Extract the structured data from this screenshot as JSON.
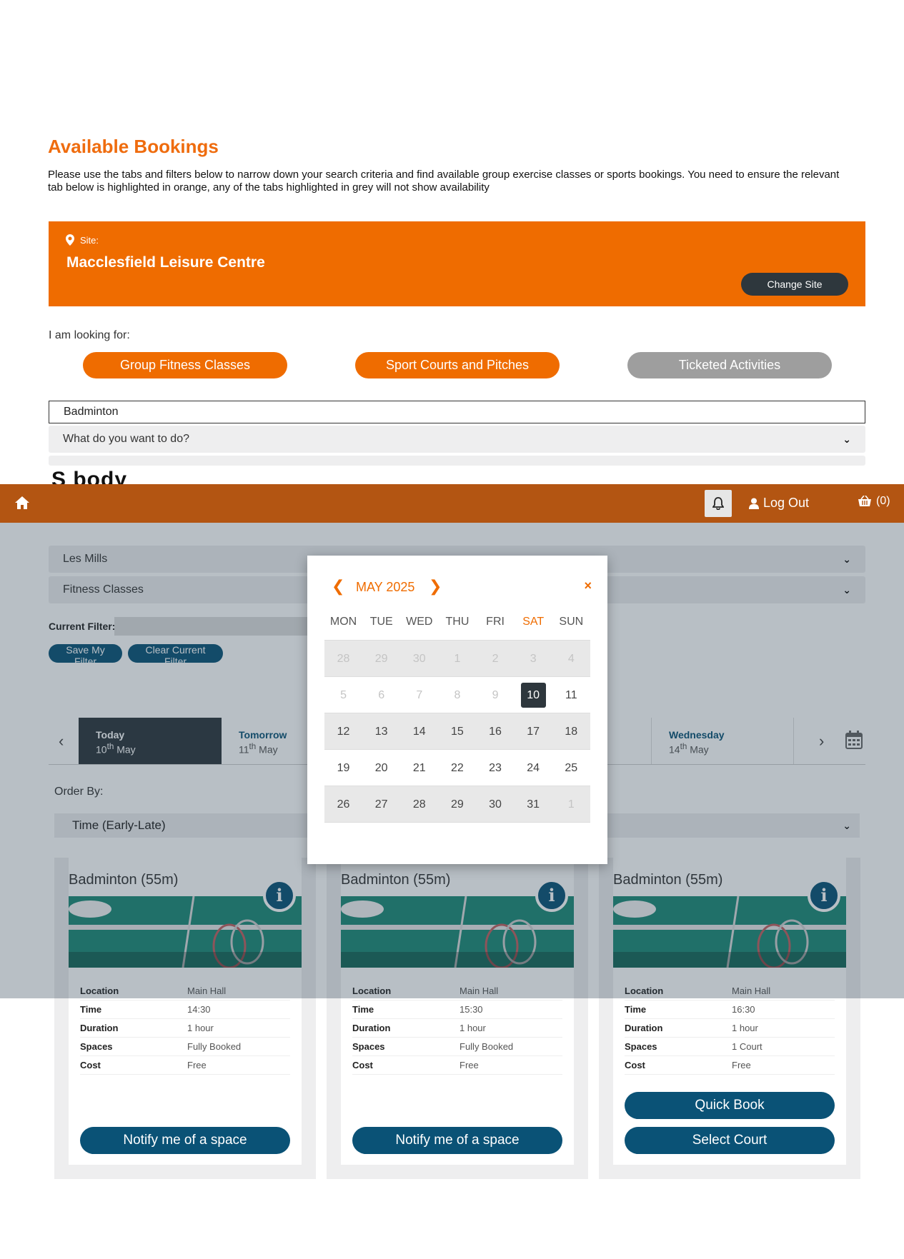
{
  "page": {
    "title": "Available Bookings",
    "intro": "Please use the tabs and filters below to narrow down your search criteria and find available group exercise classes or sports bookings. You need to ensure the relevant tab below is highlighted in orange, any of the tabs highlighted in grey will not show availability"
  },
  "site": {
    "label": "Site:",
    "name": "Macclesfield Leisure Centre",
    "change_label": "Change Site"
  },
  "filters": {
    "looking_label": "I am looking for:",
    "tabs": [
      {
        "label": "Group Fitness Classes",
        "state": "active"
      },
      {
        "label": "Sport Courts and Pitches",
        "state": "active"
      },
      {
        "label": "Ticketed Activities",
        "state": "inactive"
      }
    ],
    "search_value": "Badminton",
    "what_placeholder": "What do you want to do?",
    "dropdowns": [
      "Les Mills",
      "Fitness Classes"
    ],
    "current_filter_label": "Current Filter:",
    "save_label": "Save My Filter",
    "clear_label": "Clear Current Filter"
  },
  "date_strip": {
    "days": [
      {
        "day": "Today",
        "num": "10",
        "sup": "th",
        "month": "May",
        "active": true
      },
      {
        "day": "Tomorrow",
        "num": "11",
        "sup": "th",
        "month": "May",
        "active": false
      },
      {
        "day": "Wednesday",
        "num": "14",
        "sup": "th",
        "month": "May",
        "active": false
      }
    ]
  },
  "order": {
    "label": "Order By:",
    "value": "Time (Early-Late)"
  },
  "topbar": {
    "logout_label": "Log Out",
    "basket_count": "(0)",
    "logo_fragment": "S       body"
  },
  "calendar": {
    "month_label": "MAY 2025",
    "close": "×",
    "dow": [
      "MON",
      "TUE",
      "WED",
      "THU",
      "FRI",
      "SAT",
      "SUN"
    ],
    "weeks": [
      [
        "28",
        "29",
        "30",
        "1",
        "2",
        "3",
        "4"
      ],
      [
        "5",
        "6",
        "7",
        "8",
        "9",
        "10",
        "11"
      ],
      [
        "12",
        "13",
        "14",
        "15",
        "16",
        "17",
        "18"
      ],
      [
        "19",
        "20",
        "21",
        "22",
        "23",
        "24",
        "25"
      ],
      [
        "26",
        "27",
        "28",
        "29",
        "30",
        "31",
        "1"
      ]
    ],
    "selected": "10"
  },
  "detail_labels": {
    "location": "Location",
    "time": "Time",
    "duration": "Duration",
    "spaces": "Spaces",
    "cost": "Cost"
  },
  "cards": [
    {
      "title": "Badminton (55m)",
      "location": "Main Hall",
      "time": "14:30",
      "duration": "1 hour",
      "spaces": "Fully Booked",
      "cost": "Free",
      "buttons": [
        "Notify me of a space"
      ]
    },
    {
      "title": "Badminton (55m)",
      "location": "Main Hall",
      "time": "15:30",
      "duration": "1 hour",
      "spaces": "Fully Booked",
      "cost": "Free",
      "buttons": [
        "Notify me of a space"
      ]
    },
    {
      "title": "Badminton (55m)",
      "location": "Main Hall",
      "time": "16:30",
      "duration": "1 hour",
      "spaces": "1 Court",
      "cost": "Free",
      "buttons": [
        "Quick Book",
        "Select Court"
      ]
    }
  ],
  "colors": {
    "accent": "#ef6c00",
    "topbar": "#b35512",
    "button_blue": "#0a5276",
    "dark": "#2e373d",
    "inactive_tab": "#9e9e9e"
  },
  "icons": {
    "site": "map-marker-icon",
    "home": "home-icon",
    "bell": "bell-icon",
    "user": "user-icon",
    "basket": "basket-icon",
    "calendar": "calendar-icon",
    "info": "info-icon"
  }
}
